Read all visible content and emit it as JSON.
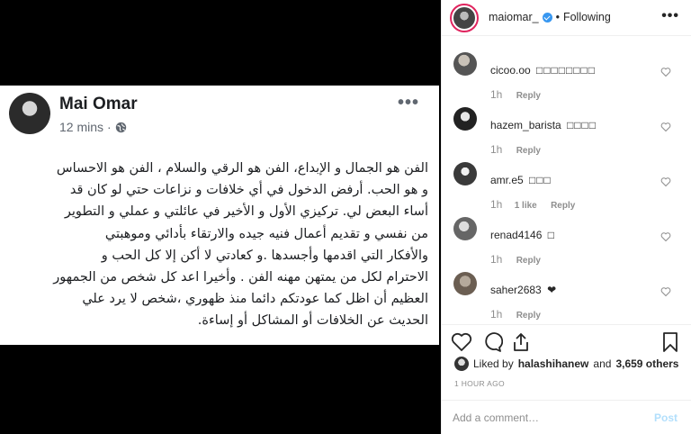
{
  "facebook_post": {
    "author": "Mai Omar",
    "time": "12 mins",
    "separator": "·",
    "more": "•••",
    "body_lines": [
      "الفن هو الجمال و الإبداع،  الفن هو الرقي والسلام ، الفن هو الاحساس",
      "و هو الحب. أرفض الدخول في أي خلافات و نزاعات حتي لو كان قد",
      "أساء البعض لي. تركيزي الأول و الأخير في عائلتي و عملي و التطوير",
      "من نفسي و تقديم أعمال فنيه جيده والارتقاء بأدائي وموهبتي",
      "والأفكار التي اقدمها وأجسدها .و كعادتي لا أكن إلا كل الحب و",
      "الاحترام لكل من يمتهن مهنه الفن . وأخيرا اعد كل شخص من الجمهور",
      "العظيم أن اظل كما عودتكم دائما منذ ظهوري ،شخص لا يرد علي",
      "الحديث عن الخلافات أو المشاكل أو إساءة."
    ]
  },
  "instagram": {
    "username": "maiomar_",
    "dot": "•",
    "follow_status": "Following",
    "more": "•••",
    "comments": [
      {
        "user": "cicoo.oo",
        "text": "□□□□□□□□",
        "time": "1h",
        "likes": "",
        "reply": "Reply"
      },
      {
        "user": "hazem_barista",
        "text": "□□□□",
        "time": "1h",
        "likes": "",
        "reply": "Reply"
      },
      {
        "user": "amr.e5",
        "text": "□□□",
        "time": "1h",
        "likes": "1 like",
        "reply": "Reply"
      },
      {
        "user": "renad4146",
        "text": "□",
        "time": "1h",
        "likes": "",
        "reply": "Reply"
      },
      {
        "user": "saher2683",
        "text": "❤",
        "time": "1h",
        "likes": "",
        "reply": "Reply"
      }
    ],
    "likes_prefix": "Liked by",
    "liked_by_user": "halashihanew",
    "likes_and": "and",
    "likes_others": "3,659 others",
    "post_time": "1 HOUR AGO",
    "comment_placeholder": "Add a comment…",
    "post_label": "Post",
    "icons": [
      "heart-icon",
      "comment-icon",
      "share-icon",
      "bookmark-icon"
    ]
  },
  "colors": {
    "background_media": "#000000",
    "verified": "#3897f0",
    "post_button_disabled": "#b2dffc",
    "muted_text": "#8e8e8e"
  }
}
